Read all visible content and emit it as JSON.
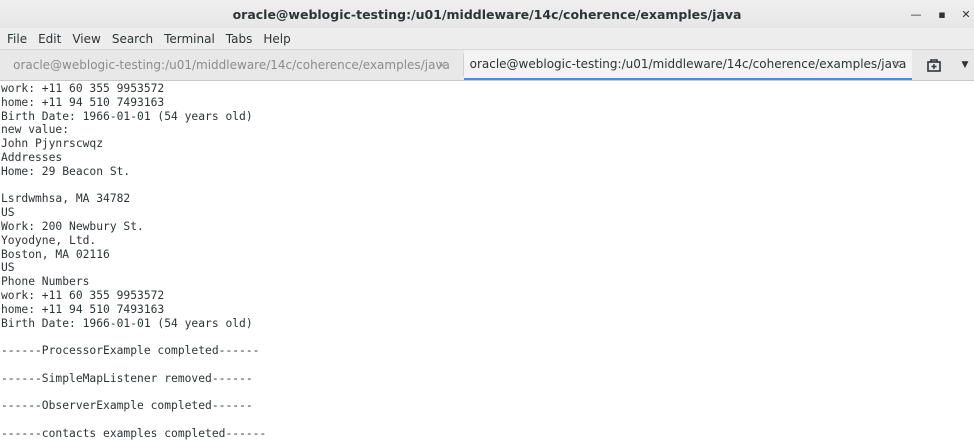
{
  "window": {
    "title": "oracle@weblogic-testing:/u01/middleware/14c/coherence/examples/java",
    "minimize_glyph": "—",
    "maximize_glyph": "▪",
    "close_glyph": "✕"
  },
  "menubar": {
    "items": [
      "File",
      "Edit",
      "View",
      "Search",
      "Terminal",
      "Tabs",
      "Help"
    ]
  },
  "tabs": [
    {
      "label": "oracle@weblogic-testing:/u01/middleware/14c/coherence/examples/java",
      "close": "×",
      "active": false
    },
    {
      "label": "oracle@weblogic-testing:/u01/middleware/14c/coherence/examples/java",
      "close": "×",
      "active": true
    }
  ],
  "tabbar": {
    "new_tab_icon": "new-tab-icon",
    "menu_glyph": "▼"
  },
  "terminal": {
    "lines": [
      "work: +11 60 355 9953572",
      "home: +11 94 510 7493163",
      "Birth Date: 1966-01-01 (54 years old)",
      "new value:",
      "John Pjynrscwqz",
      "Addresses",
      "Home: 29 Beacon St.",
      "",
      "Lsrdwmhsa, MA 34782",
      "US",
      "Work: 200 Newbury St.",
      "Yoyodyne, Ltd.",
      "Boston, MA 02116",
      "US",
      "Phone Numbers",
      "work: +11 60 355 9953572",
      "home: +11 94 510 7493163",
      "Birth Date: 1966-01-01 (54 years old)",
      "",
      "------ProcessorExample completed------",
      "",
      "------SimpleMapListener removed------",
      "",
      "------ObserverExample completed------",
      "",
      "------contacts examples completed------"
    ]
  }
}
